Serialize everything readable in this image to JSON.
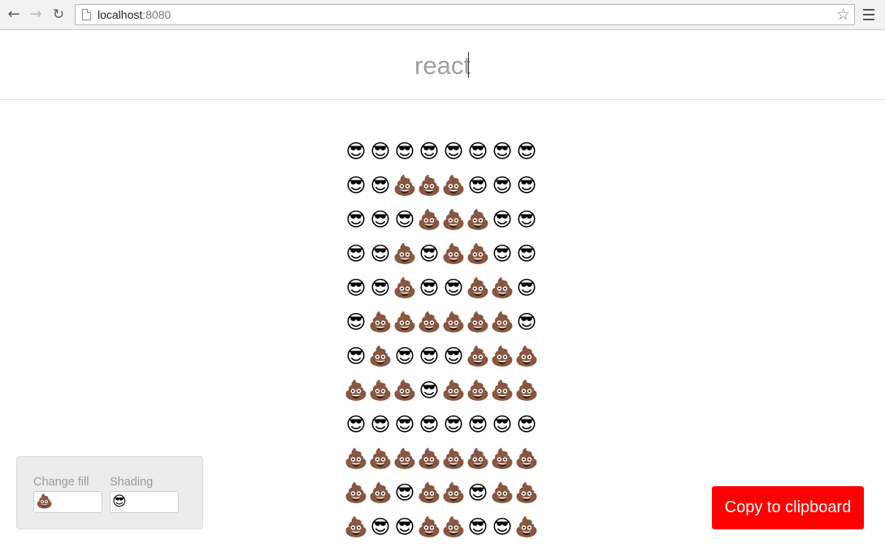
{
  "browser": {
    "url_host": "localhost",
    "url_port": ":8080",
    "back_icon": "arrow-left-icon",
    "forward_icon": "arrow-right-icon",
    "reload_icon": "reload-icon",
    "star_icon": "star-icon",
    "menu_icon": "hamburger-icon"
  },
  "search": {
    "value": "react"
  },
  "emoji": {
    "fill": "💩",
    "shade": "😎"
  },
  "grid_pattern": [
    "SSSSSSSS",
    "SSFFFSSS",
    "SSSFFFSS",
    "SSFSFFSS",
    "SSFSSFFS",
    "SFFFFFFS",
    "SFSSSFFF",
    "FFFSFFFF",
    "SSSSSSSS",
    "FFFFFFFF",
    "FFSFFSFF",
    "FSSFFSSF"
  ],
  "controls": {
    "fill_label": "Change fill",
    "fill_value": "💩",
    "shading_label": "Shading",
    "shading_value": "😎"
  },
  "copy_button": {
    "label": "Copy to clipboard",
    "color": "#ff0000"
  }
}
